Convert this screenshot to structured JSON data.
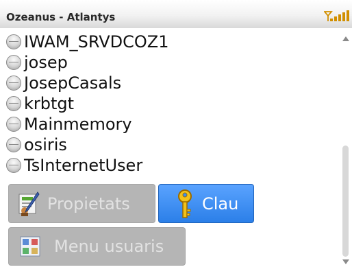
{
  "title_bar": {
    "title": "Ozeanus - Atlantys",
    "signal_icon": "wifi-signal-bars-icon"
  },
  "users": [
    {
      "name": "IWAM_SRVDCOZ1",
      "icon": "status-bullet-icon"
    },
    {
      "name": "josep",
      "icon": "status-bullet-icon"
    },
    {
      "name": "JosepCasals",
      "icon": "status-bullet-icon"
    },
    {
      "name": "krbtgt",
      "icon": "status-bullet-icon"
    },
    {
      "name": "Mainmemory",
      "icon": "status-bullet-icon"
    },
    {
      "name": "osiris",
      "icon": "status-bullet-icon"
    },
    {
      "name": "TsInternetUser",
      "icon": "status-bullet-icon"
    }
  ],
  "buttons": {
    "properties": {
      "label": "Propietats",
      "icon": "edit-document-icon",
      "state": "disabled"
    },
    "key": {
      "label": "Clau",
      "icon": "key-icon",
      "state": "selected"
    },
    "user_menu": {
      "label": "Menu usuaris",
      "icon": "user-menu-icon",
      "state": "disabled"
    }
  },
  "colors": {
    "selected_button": "#2b7fe8",
    "disabled_button": "#b5b5b5"
  }
}
